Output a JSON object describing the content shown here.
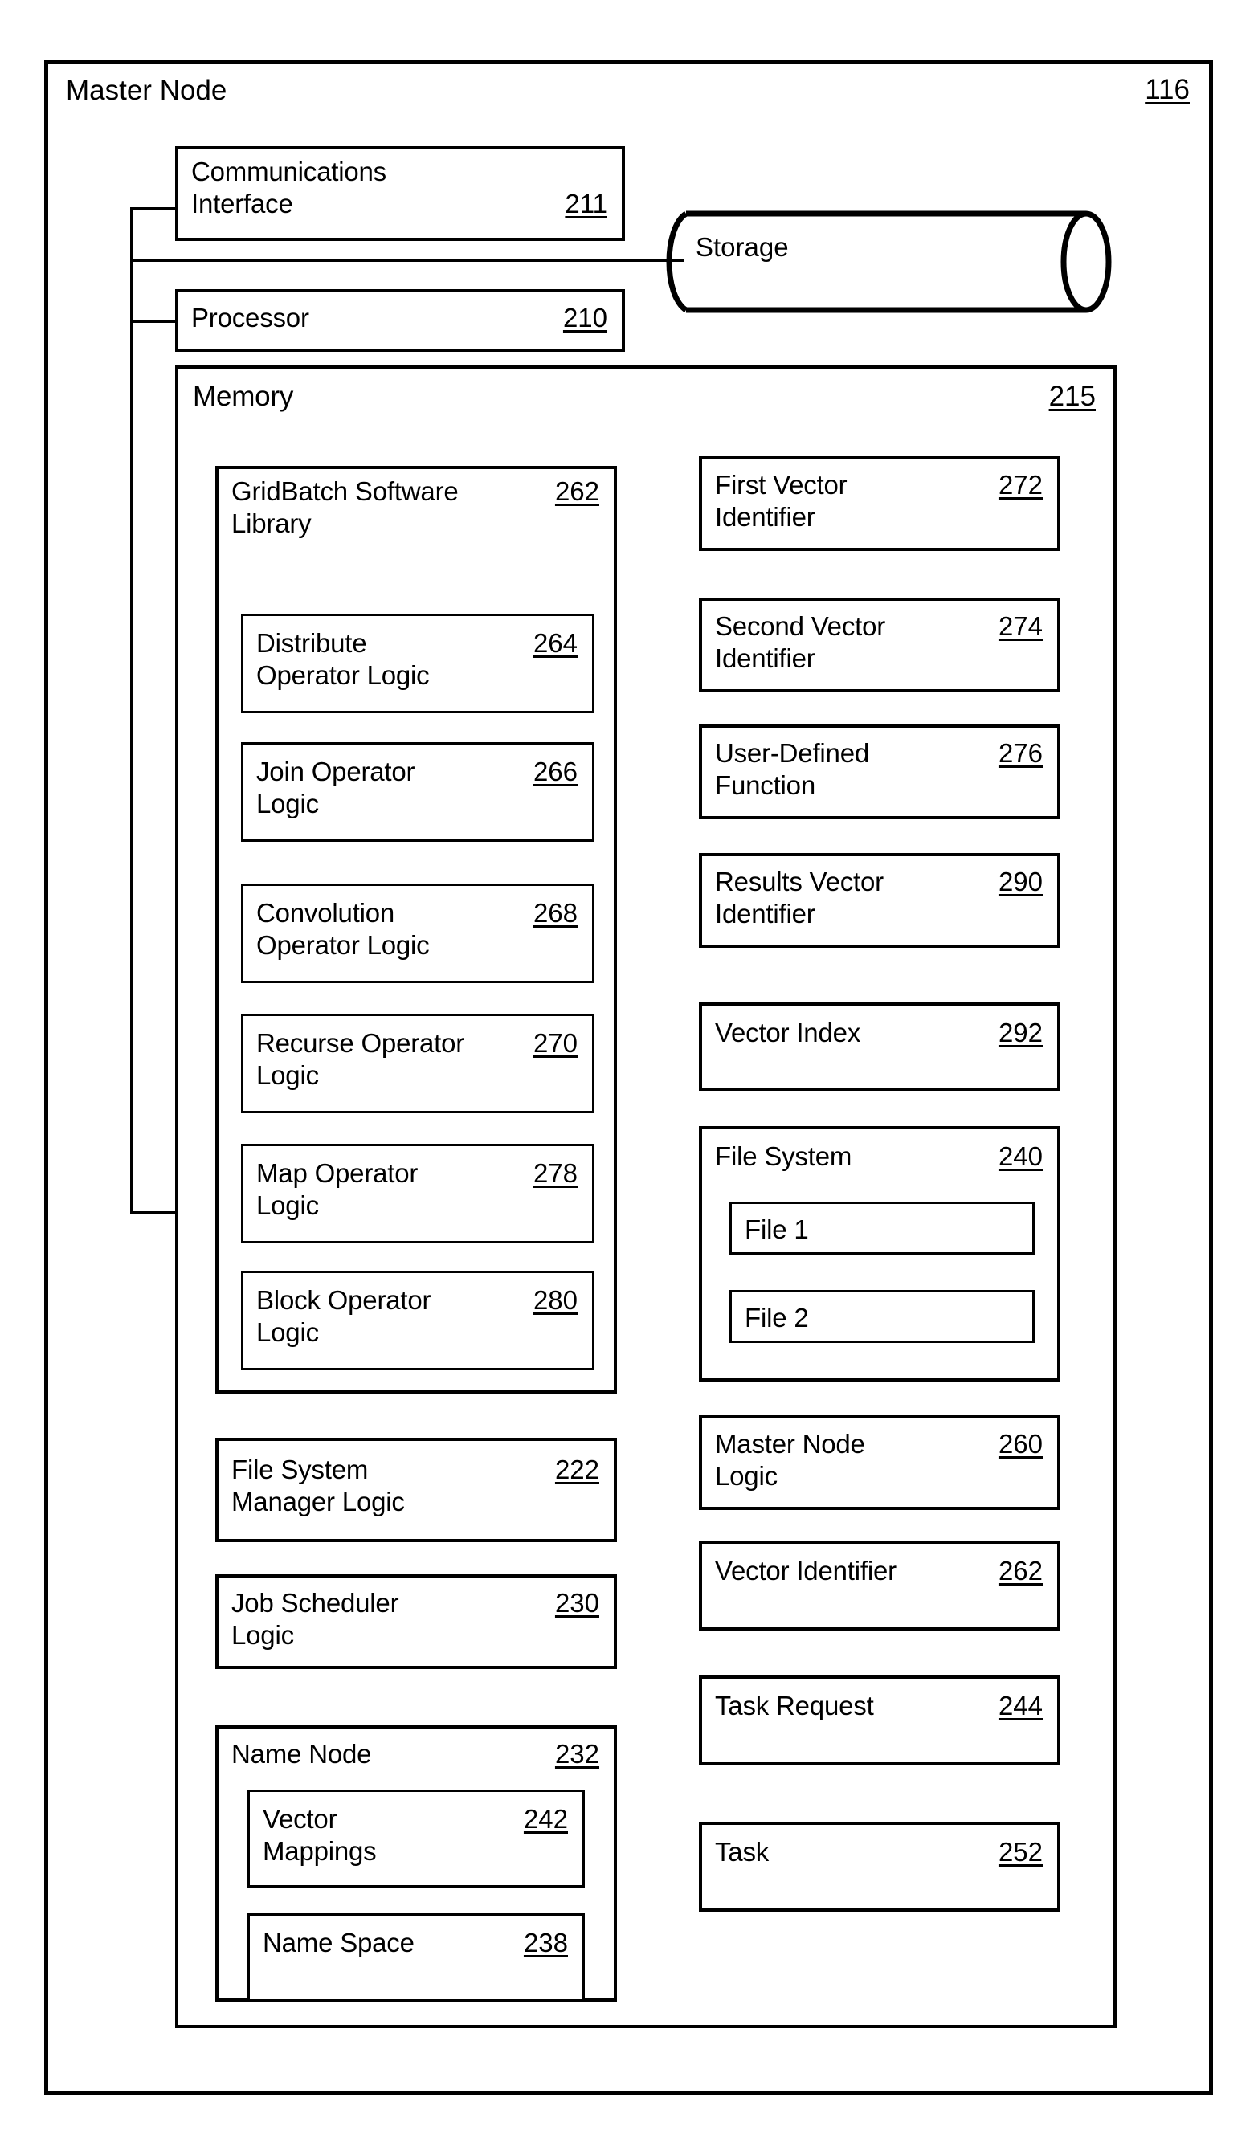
{
  "figure": {
    "outer": {
      "title": "Master Node",
      "ref": "116"
    },
    "storage": {
      "label": "Storage"
    },
    "communications_interface": {
      "label": "Communications\nInterface",
      "ref": "211"
    },
    "processor": {
      "label": "Processor",
      "ref": "210"
    },
    "memory": {
      "title": "Memory",
      "ref": "215"
    },
    "gridbatch_library": {
      "label": "GridBatch Software\nLibrary",
      "ref": "262",
      "operators": [
        {
          "label": "Distribute\nOperator Logic",
          "ref": "264"
        },
        {
          "label": "Join Operator\nLogic",
          "ref": "266"
        },
        {
          "label": "Convolution\nOperator Logic",
          "ref": "268"
        },
        {
          "label": "Recurse Operator\nLogic",
          "ref": "270"
        },
        {
          "label": "Map Operator\nLogic",
          "ref": "278"
        },
        {
          "label": "Block Operator\nLogic",
          "ref": "280"
        }
      ]
    },
    "left_column_boxes": [
      {
        "label": "File System\nManager Logic",
        "ref": "222"
      },
      {
        "label": "Job Scheduler\nLogic",
        "ref": "230"
      }
    ],
    "name_node": {
      "label": "Name Node",
      "ref": "232",
      "children": [
        {
          "label": "Vector\nMappings",
          "ref": "242"
        },
        {
          "label": "Name Space",
          "ref": "238"
        }
      ]
    },
    "right_column_boxes": [
      {
        "label": "First Vector\nIdentifier",
        "ref": "272"
      },
      {
        "label": "Second Vector\nIdentifier",
        "ref": "274"
      },
      {
        "label": "User-Defined\nFunction",
        "ref": "276"
      },
      {
        "label": "Results Vector\nIdentifier",
        "ref": "290"
      },
      {
        "label": "Vector Index",
        "ref": "292"
      }
    ],
    "file_system": {
      "label": "File System",
      "ref": "240",
      "files": [
        {
          "label": "File 1"
        },
        {
          "label": "File 2"
        }
      ]
    },
    "right_column_boxes_lower": [
      {
        "label": "Master Node\nLogic",
        "ref": "260"
      },
      {
        "label": "Vector Identifier",
        "ref": "262"
      },
      {
        "label": "Task Request",
        "ref": "244"
      },
      {
        "label": "Task",
        "ref": "252"
      }
    ]
  }
}
